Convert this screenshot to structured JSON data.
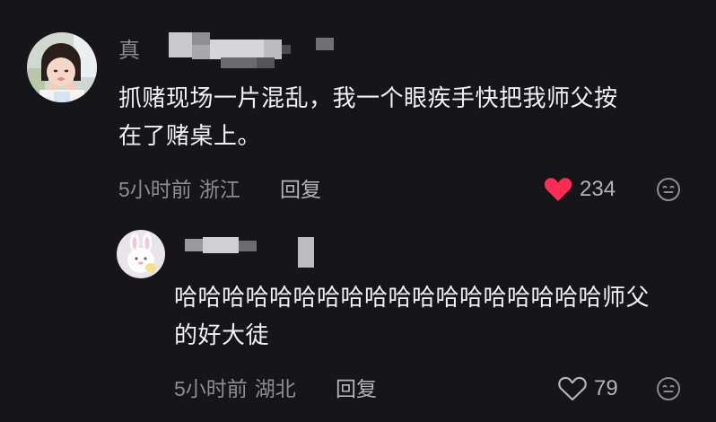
{
  "comments": [
    {
      "username_visible_char": "真",
      "text_line1": "抓赌现场一片混乱，我一个眼疾手快把我师父按",
      "text_line2": "在了赌桌上。",
      "time": "5小时前",
      "location": "浙江",
      "reply_label": "回复",
      "like_count": "234",
      "liked": true
    },
    {
      "text_line1": "哈哈哈哈哈哈哈哈哈哈哈哈哈哈哈哈哈哈师父",
      "text_line2": "的好大徒",
      "time": "5小时前",
      "location": "湖北",
      "reply_label": "回复",
      "like_count": "79",
      "liked": false
    }
  ],
  "colors": {
    "background": "#16161a",
    "liked_heart": "#ff2d55",
    "primary_text": "#f2f2f2",
    "secondary_text": "#8c8c91"
  },
  "icons": {
    "like_filled": "heart-filled-icon",
    "like_outline": "heart-outline-icon",
    "emoji": "emoji-face-icon"
  }
}
